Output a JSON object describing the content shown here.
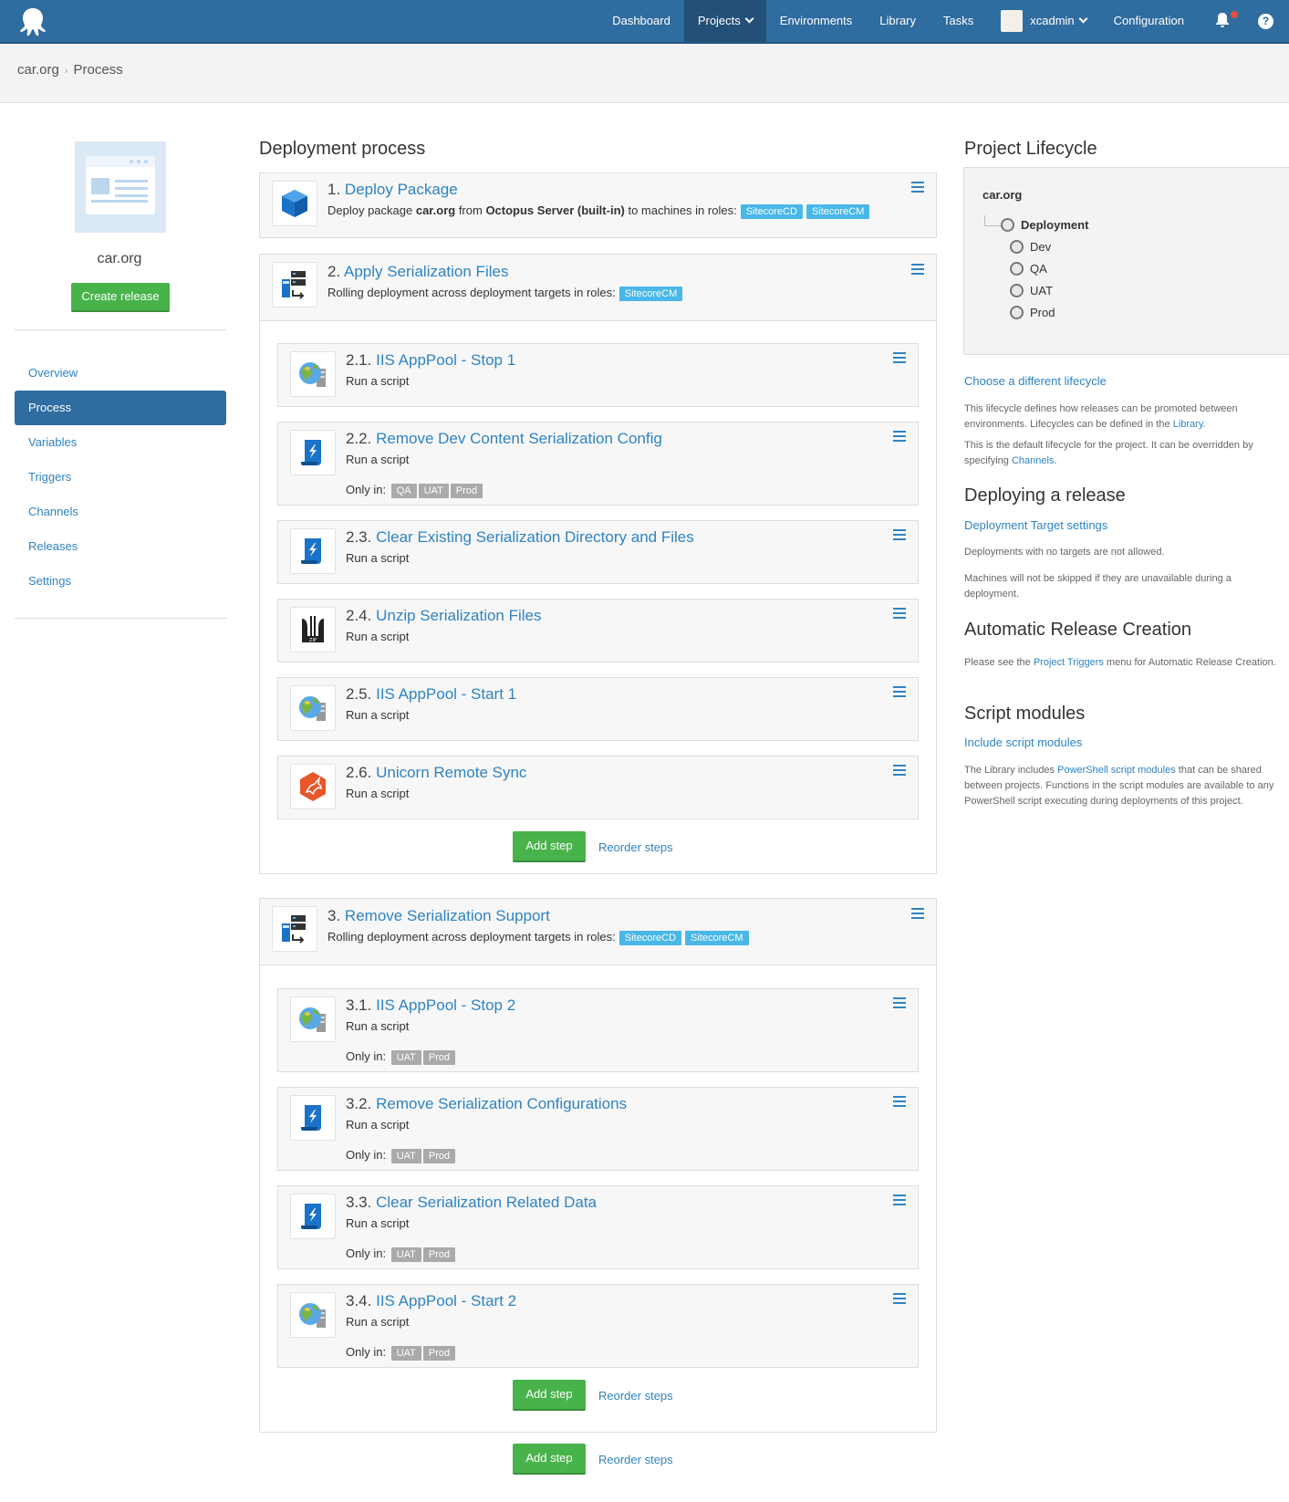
{
  "nav": {
    "items": [
      "Dashboard",
      "Projects",
      "Environments",
      "Library",
      "Tasks",
      "xcadmin",
      "Configuration"
    ],
    "help": "?"
  },
  "breadcrumb": {
    "project": "car.org",
    "page": "Process"
  },
  "sidebar": {
    "project_name": "car.org",
    "create_release": "Create release",
    "items": [
      "Overview",
      "Process",
      "Variables",
      "Triggers",
      "Channels",
      "Releases",
      "Settings"
    ]
  },
  "main": {
    "title": "Deployment process",
    "steps": [
      {
        "num": "1.",
        "name": "Deploy Package",
        "desc_pre": "Deploy package ",
        "desc_pkg": "car.org",
        "desc_mid": " from ",
        "desc_feed": "Octopus Server (built-in)",
        "desc_post": " to machines in roles:",
        "roles": [
          "SitecoreCD",
          "SitecoreCM"
        ]
      },
      {
        "num": "2.",
        "name": "Apply Serialization Files",
        "desc": "Rolling deployment across deployment targets in roles:",
        "roles": [
          "SitecoreCM"
        ],
        "children": [
          {
            "num": "2.1.",
            "name": "IIS AppPool - Stop 1",
            "desc": "Run a script"
          },
          {
            "num": "2.2.",
            "name": "Remove Dev Content Serialization Config",
            "desc": "Run a script",
            "only_in_label": "Only in:",
            "only_in": [
              "QA",
              "UAT",
              "Prod"
            ]
          },
          {
            "num": "2.3.",
            "name": "Clear Existing Serialization Directory and Files",
            "desc": "Run a script"
          },
          {
            "num": "2.4.",
            "name": "Unzip Serialization Files",
            "desc": "Run a script"
          },
          {
            "num": "2.5.",
            "name": "IIS AppPool - Start 1",
            "desc": "Run a script"
          },
          {
            "num": "2.6.",
            "name": "Unicorn Remote Sync",
            "desc": "Run a script"
          }
        ]
      },
      {
        "num": "3.",
        "name": "Remove Serialization Support",
        "desc": "Rolling deployment across deployment targets in roles:",
        "roles": [
          "SitecoreCD",
          "SitecoreCM"
        ],
        "children": [
          {
            "num": "3.1.",
            "name": "IIS AppPool - Stop 2",
            "desc": "Run a script",
            "only_in_label": "Only in:",
            "only_in": [
              "UAT",
              "Prod"
            ]
          },
          {
            "num": "3.2.",
            "name": "Remove Serialization Configurations",
            "desc": "Run a script",
            "only_in_label": "Only in:",
            "only_in": [
              "UAT",
              "Prod"
            ]
          },
          {
            "num": "3.3.",
            "name": "Clear Serialization Related Data",
            "desc": "Run a script",
            "only_in_label": "Only in:",
            "only_in": [
              "UAT",
              "Prod"
            ]
          },
          {
            "num": "3.4.",
            "name": "IIS AppPool - Start 2",
            "desc": "Run a script",
            "only_in_label": "Only in:",
            "only_in": [
              "UAT",
              "Prod"
            ]
          }
        ]
      }
    ],
    "add_step": "Add step",
    "reorder_steps": "Reorder steps"
  },
  "lifecycle": {
    "title": "Project Lifecycle",
    "name": "car.org",
    "phase": "Deployment",
    "environments": [
      "Dev",
      "QA",
      "UAT",
      "Prod"
    ],
    "choose_link": "Choose a different lifecycle",
    "info1_pre": "This lifecycle defines how releases can be promoted between environments. Lifecycles can be defined in the ",
    "info1_link": "Library",
    "info1_post": ".",
    "info2_pre": "This is the default lifecycle for the project. It can be overridden by specifying ",
    "info2_link": "Channels",
    "info2_post": "."
  },
  "deploying": {
    "title": "Deploying a release",
    "link": "Deployment Target settings",
    "text1": "Deployments with no targets are not allowed.",
    "text2": "Machines will not be skipped if they are unavailable during a deployment."
  },
  "auto_release": {
    "title": "Automatic Release Creation",
    "pre": "Please see the ",
    "link": "Project Triggers",
    "post": " menu for Automatic Release Creation."
  },
  "script_modules": {
    "title": "Script modules",
    "link": "Include script modules",
    "pre": "The Library includes ",
    "text_link": "PowerShell script modules",
    "post": " that can be shared between projects. Functions in the script modules are available to any PowerShell script executing during deployments of this project."
  },
  "colors": {
    "nav": "#2f6c9f",
    "link": "#2f83c2",
    "green": "#48b34a",
    "role_tag": "#49b7e8",
    "env_tag": "#aaaaaa"
  },
  "icons": {
    "package": "package-icon",
    "rolling": "rolling-deployment-icon",
    "iis": "iis-globe-icon",
    "script": "powershell-script-icon",
    "zip": "zip-icon",
    "unicorn": "unicorn-icon"
  }
}
